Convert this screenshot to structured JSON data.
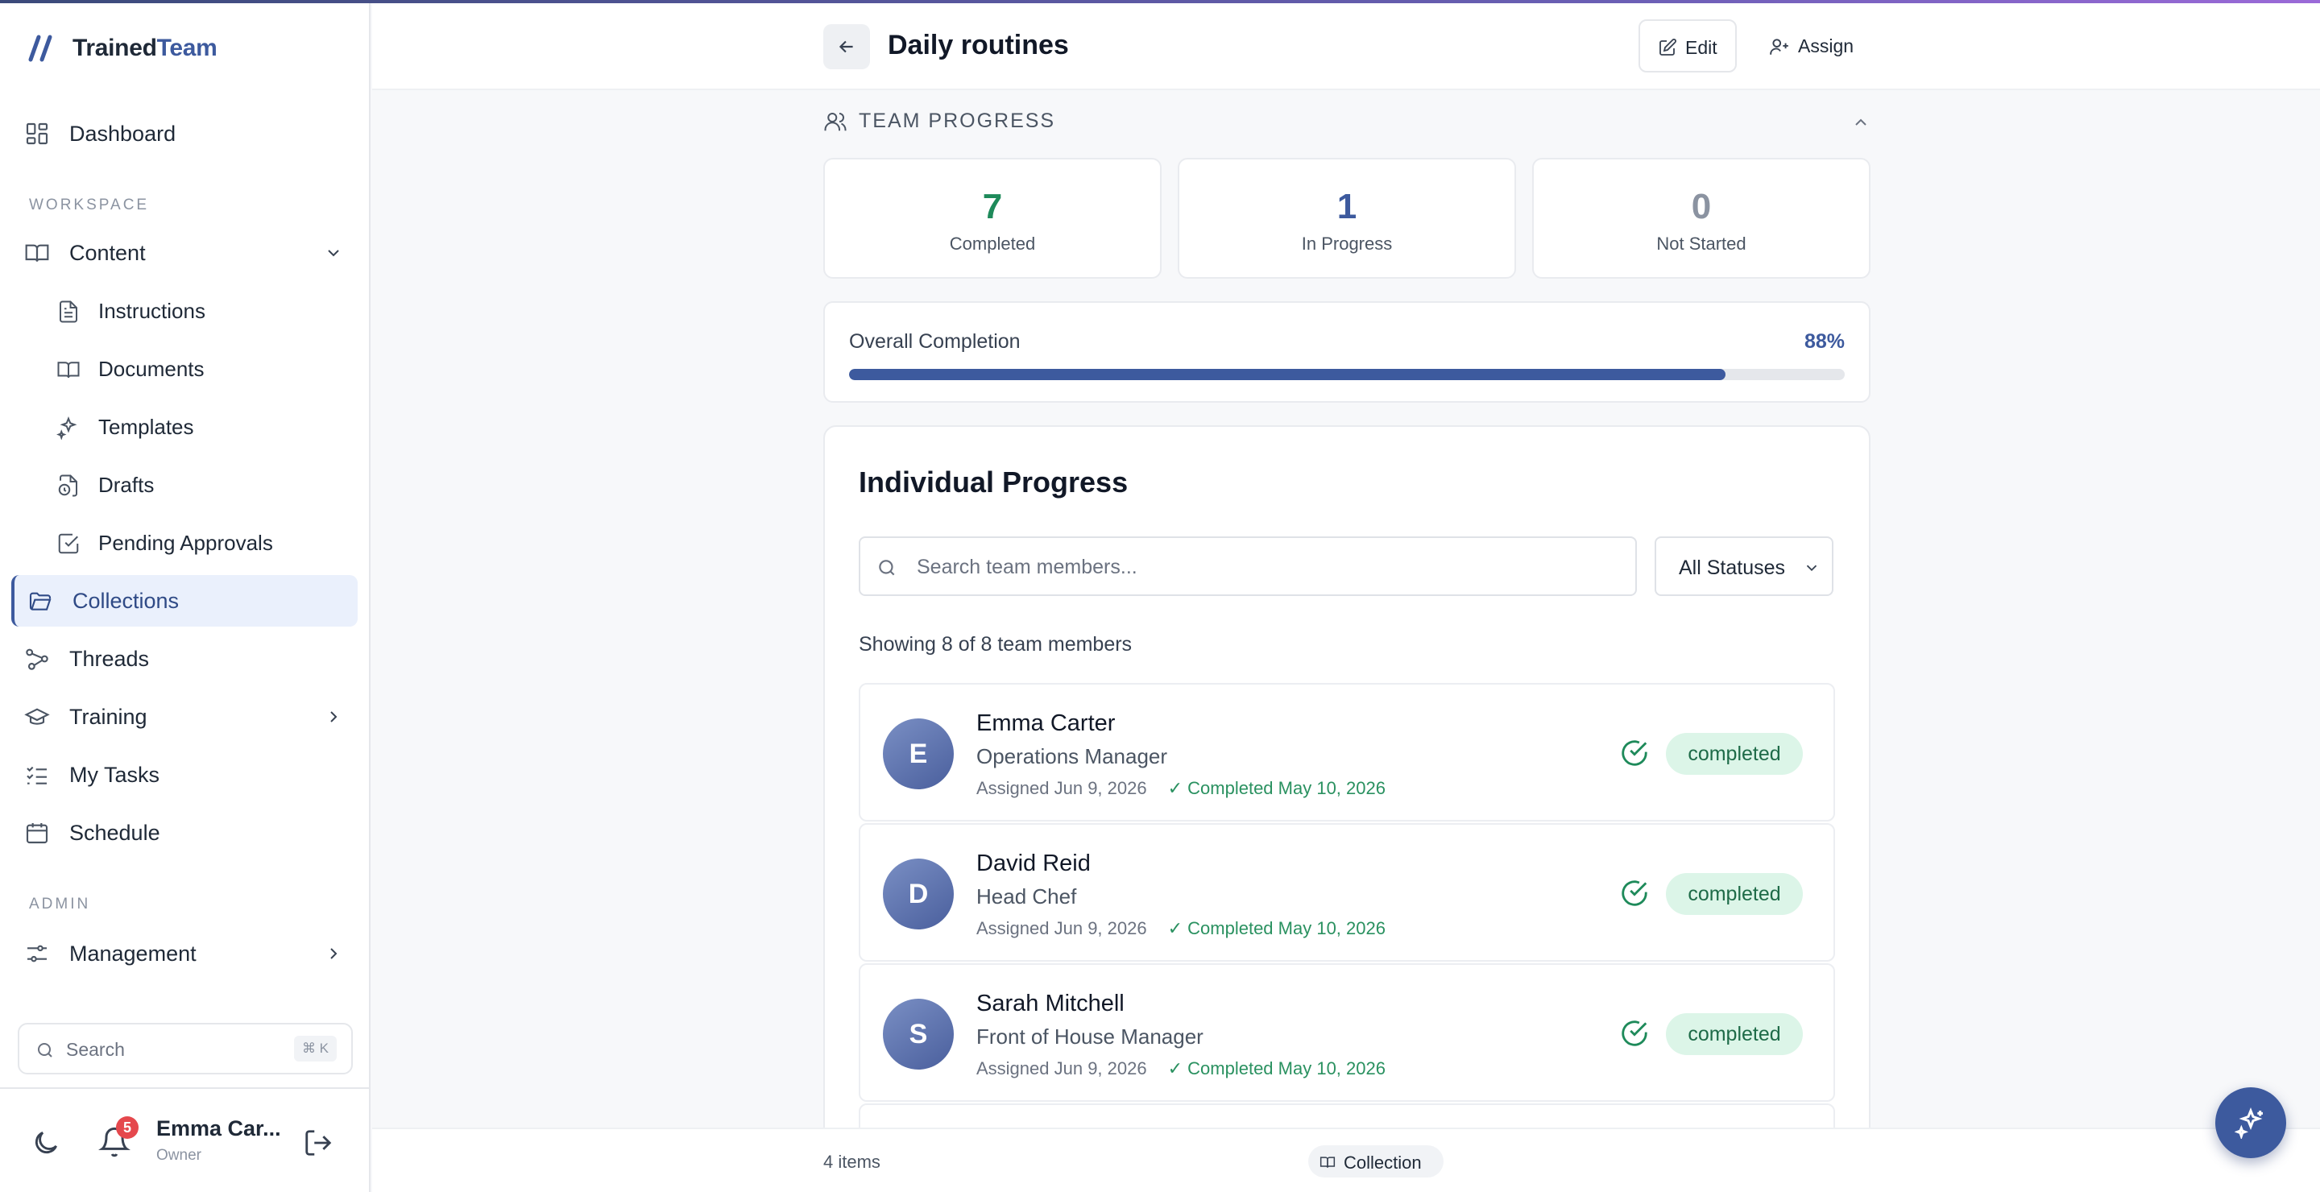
{
  "app": {
    "name_part1": "Trained",
    "name_part2": "Team"
  },
  "sidebar": {
    "dashboard": "Dashboard",
    "workspace_label": "WORKSPACE",
    "content": "Content",
    "sub_items": [
      "Instructions",
      "Documents",
      "Templates",
      "Drafts",
      "Pending Approvals"
    ],
    "collections": "Collections",
    "threads": "Threads",
    "training": "Training",
    "my_tasks": "My Tasks",
    "schedule": "Schedule",
    "admin_label": "ADMIN",
    "management": "Management",
    "search_placeholder": "Search",
    "search_shortcut": "⌘ K",
    "notification_count": "5",
    "user_name": "Emma Car...",
    "user_role": "Owner"
  },
  "header": {
    "title": "Daily routines",
    "edit_label": "Edit",
    "assign_label": "Assign"
  },
  "team_progress": {
    "title": "TEAM PROGRESS",
    "stats": [
      {
        "value": "7",
        "label": "Completed",
        "color": "#1e8a5a"
      },
      {
        "value": "1",
        "label": "In Progress",
        "color": "#3d5a9e"
      },
      {
        "value": "0",
        "label": "Not Started",
        "color": "#8b93a1"
      }
    ],
    "overall_label": "Overall Completion",
    "overall_percent_text": "88%",
    "overall_fraction": 0.88
  },
  "individual": {
    "title": "Individual Progress",
    "search_placeholder": "Search team members...",
    "status_filter": "All Statuses",
    "showing_text": "Showing 8 of 8 team members",
    "members": [
      {
        "initial": "E",
        "name": "Emma Carter",
        "role": "Operations Manager",
        "assigned": "Assigned Jun 9, 2026",
        "completed": "✓ Completed May 10, 2026",
        "status": "completed"
      },
      {
        "initial": "D",
        "name": "David Reid",
        "role": "Head Chef",
        "assigned": "Assigned Jun 9, 2026",
        "completed": "✓ Completed May 10, 2026",
        "status": "completed"
      },
      {
        "initial": "S",
        "name": "Sarah Mitchell",
        "role": "Front of House Manager",
        "assigned": "Assigned Jun 9, 2026",
        "completed": "✓ Completed May 10, 2026",
        "status": "completed"
      }
    ]
  },
  "footer": {
    "items_count": "4 items",
    "collection_label": "Collection"
  },
  "colors": {
    "accent": "#3d5a9e",
    "success": "#1e8a5a",
    "success_bg": "#dcf5e8"
  }
}
